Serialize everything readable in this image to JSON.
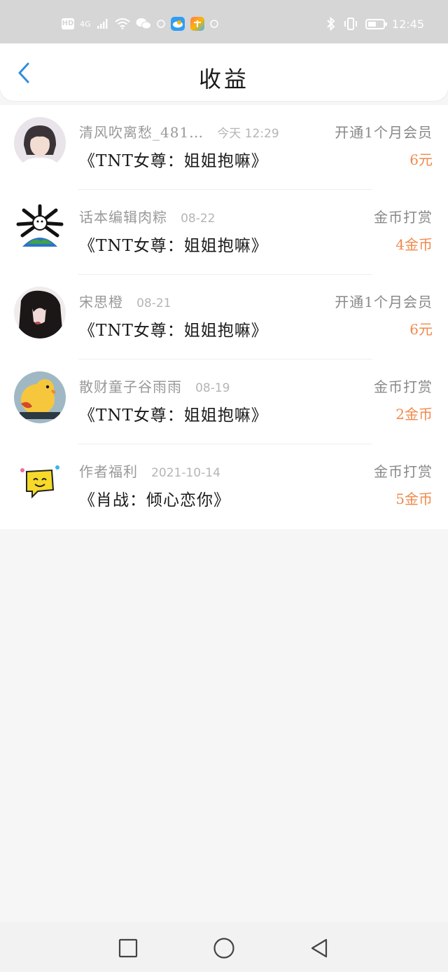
{
  "status_bar": {
    "hd": "HD",
    "network": "4G",
    "time": "12:45",
    "battery_level": 0.55
  },
  "header": {
    "title": "收益"
  },
  "records": [
    {
      "user": "清风吹离愁_481…",
      "time": "今天  12:29",
      "type": "开通1个月会员",
      "book": "《TNT女尊：姐姐抱嘛》",
      "amount": "6元",
      "avatar": "avatar-portrait-light"
    },
    {
      "user": "话本编辑肉粽",
      "time": "08-22",
      "type": "金币打赏",
      "book": "《TNT女尊：姐姐抱嘛》",
      "amount": "4金币",
      "avatar": "avatar-earth-cartoon"
    },
    {
      "user": "宋思橙",
      "time": "08-21",
      "type": "开通1个月会员",
      "book": "《TNT女尊：姐姐抱嘛》",
      "amount": "6元",
      "avatar": "avatar-dark-hair"
    },
    {
      "user": "散财童子谷雨雨",
      "time": "08-19",
      "type": "金币打赏",
      "book": "《TNT女尊：姐姐抱嘛》",
      "amount": "2金币",
      "avatar": "avatar-yellow-duck"
    },
    {
      "user": "作者福利",
      "time": "2021-10-14",
      "type": "金币打赏",
      "book": "《肖战：倾心恋你》",
      "amount": "5金币",
      "avatar": "avatar-yellow-chat"
    }
  ],
  "colors": {
    "accent": "#2f8ee0",
    "amount": "#f0894a",
    "background": "#f7f6f7"
  }
}
